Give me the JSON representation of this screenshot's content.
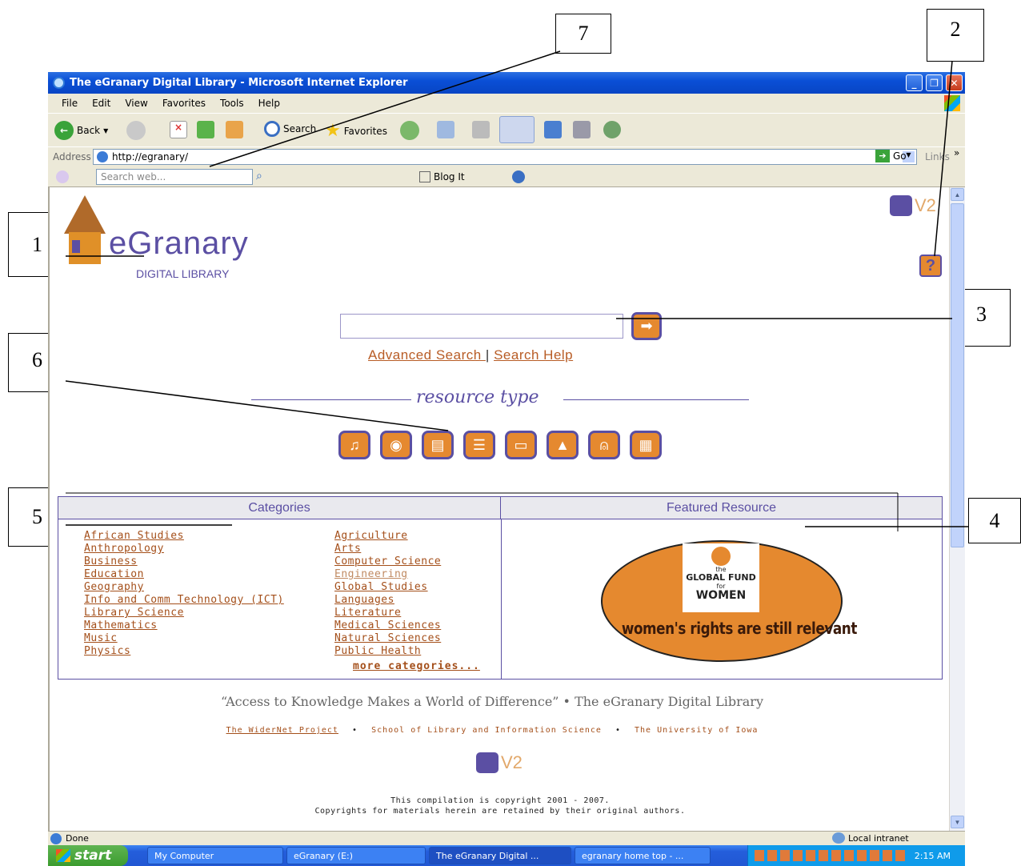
{
  "callouts": [
    "1",
    "2",
    "3",
    "4",
    "5",
    "6",
    "7"
  ],
  "window": {
    "title": "The eGranary Digital Library - Microsoft Internet Explorer"
  },
  "menu": [
    "File",
    "Edit",
    "View",
    "Favorites",
    "Tools",
    "Help"
  ],
  "toolbar": {
    "back": "Back",
    "search": "Search",
    "favorites": "Favorites"
  },
  "address": {
    "label": "Address",
    "url": "http://egranary/",
    "go": "Go",
    "links": "Links"
  },
  "searchbar": {
    "placeholder": "Search web...",
    "blog": "Blog It"
  },
  "page": {
    "logo_main": "eGranary",
    "logo_sub": "DIGITAL LIBRARY",
    "version": "V2",
    "help": "?",
    "search_value": "",
    "advanced_search": "Advanced Search ",
    "sep": "|",
    "search_help": "Search Help",
    "resource_type": "resource type",
    "resource_icons": [
      "music-icon",
      "eye-icon",
      "newspaper-icon",
      "books-icon",
      "book-icon",
      "graduation-cap-icon",
      "mouse-icon",
      "film-icon"
    ],
    "categories_header": "Categories",
    "featured_header": "Featured Resource",
    "categories_left": [
      "African Studies",
      "Anthropology",
      "Business",
      "Education",
      "Geography",
      "Info and Comm Technology (ICT)",
      "Library Science",
      "Mathematics",
      "Music",
      "Physics"
    ],
    "categories_right": [
      "Agriculture",
      "Arts",
      "Computer Science",
      "Engineering",
      "Global Studies",
      "Languages",
      "Literature",
      "Medical Sciences",
      "Natural Sciences",
      "Public Health"
    ],
    "more_categories": "more categories...",
    "featured": {
      "line1": "the",
      "line2": "GLOBAL FUND",
      "line3": "for",
      "line4": "WOMEN",
      "slogan": "women's rights are still relevant"
    },
    "quote": "“Access to Knowledge Makes a World of Difference” • The eGranary Digital Library",
    "footer_links": [
      "The WiderNet Project",
      "School of Library and Information Science",
      "The University of Iowa"
    ],
    "copyright1": "This compilation is copyright 2001 - 2007.",
    "copyright2": "Copyrights for materials herein are retained by their original authors."
  },
  "status": {
    "left": "Done",
    "right": "Local intranet"
  },
  "taskbar": {
    "start": "start",
    "tasks": [
      "My Computer",
      "eGranary (E:)",
      "The eGranary Digital ...",
      "egranary home top - ..."
    ],
    "time": "2:15 AM"
  }
}
